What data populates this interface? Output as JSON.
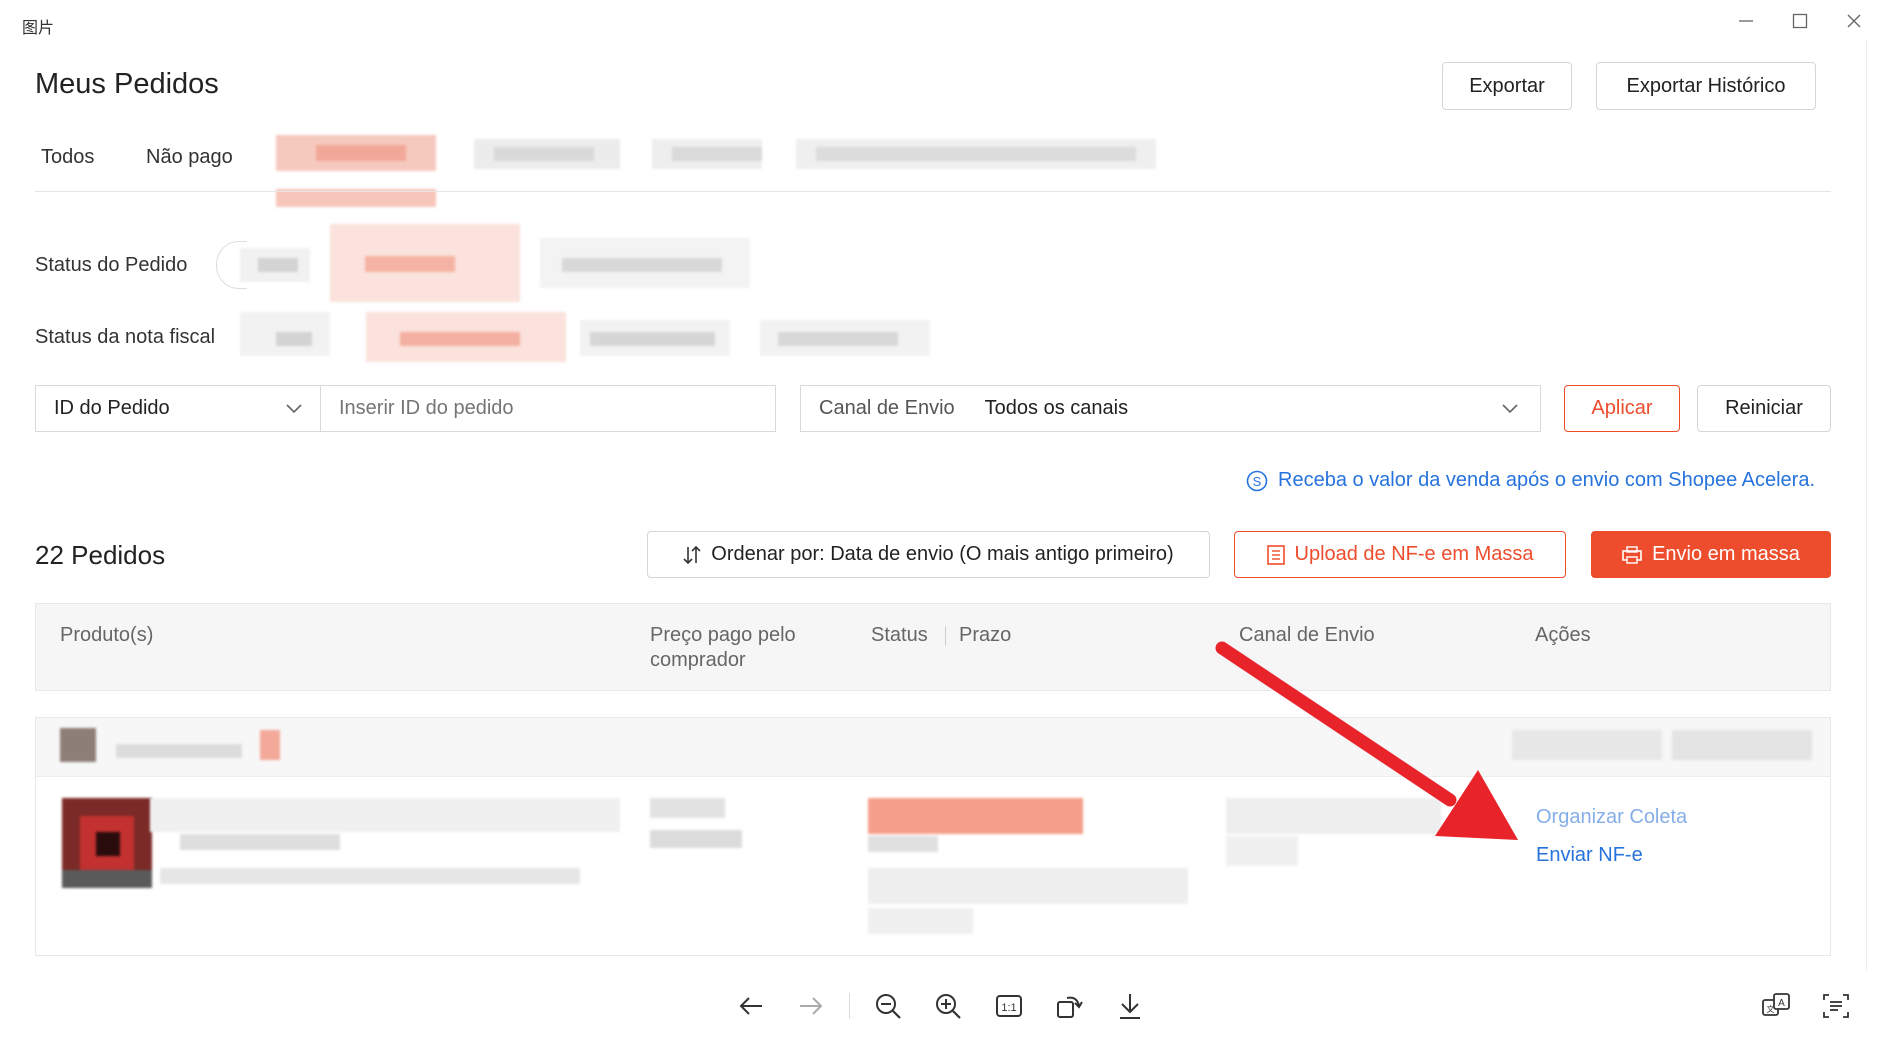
{
  "window": {
    "title": "图片",
    "controls": [
      "minimize-icon",
      "maximize-icon",
      "close-icon"
    ]
  },
  "header": {
    "title": "Meus Pedidos",
    "export_label": "Exportar",
    "export_history_label": "Exportar Histórico"
  },
  "tabs": [
    "Todos",
    "Não pago"
  ],
  "filters": {
    "order_status_label": "Status do Pedido",
    "invoice_status_label": "Status da nota fiscal"
  },
  "search": {
    "field_select": "ID do Pedido",
    "placeholder": "Inserir ID do pedido",
    "channel_label": "Canal de Envio",
    "channel_value": "Todos os canais",
    "apply_label": "Aplicar",
    "reset_label": "Reiniciar"
  },
  "promo": {
    "icon": "dollar-circle-icon",
    "text": "Receba o valor da venda após o envio com Shopee Acelera."
  },
  "orders": {
    "count_label": "22 Pedidos",
    "sort_label": "Ordenar por: Data de envio (O mais antigo primeiro)",
    "upload_label": "Upload de NF-e em Massa",
    "bulk_ship_label": "Envio em massa"
  },
  "table": {
    "headers": {
      "product": "Produto(s)",
      "price_line1": "Preço pago pelo",
      "price_line2": "comprador",
      "status": "Status",
      "deadline": "Prazo",
      "channel": "Canal de Envio",
      "actions": "Ações"
    },
    "row_actions": {
      "arrange_pickup": "Organizar Coleta",
      "send_nfe": "Enviar NF-e"
    }
  },
  "viewer_toolbar": [
    "arrow-left-icon",
    "arrow-right-icon",
    "zoom-out-icon",
    "zoom-in-icon",
    "actual-size-icon",
    "rotate-icon",
    "download-icon"
  ],
  "viewer_extra": [
    "translate-icon",
    "ocr-icon"
  ],
  "colors": {
    "accent": "#ee4d2d",
    "link": "#2673dd",
    "arrow": "#e8232a"
  }
}
